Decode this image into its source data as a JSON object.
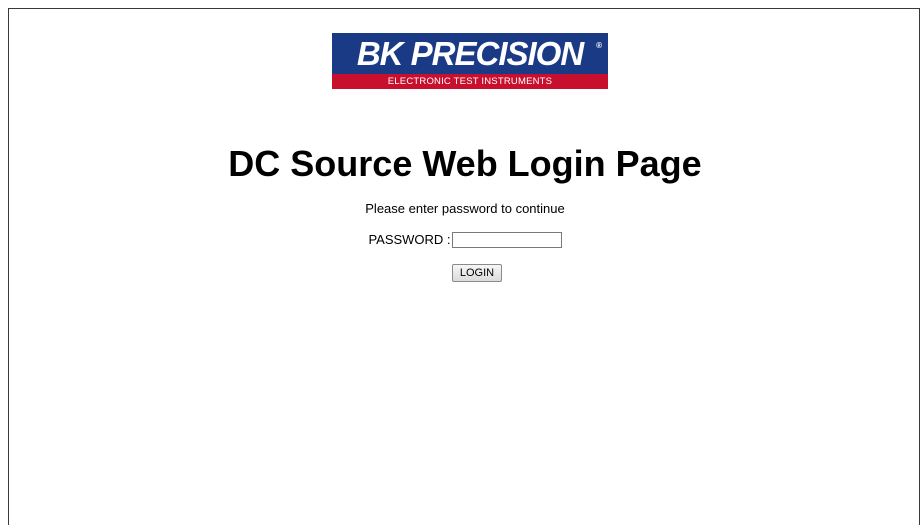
{
  "logo": {
    "brand": "BK PRECISION",
    "registered_mark": "®",
    "tagline": "ELECTRONIC TEST INSTRUMENTS",
    "colors": {
      "primary": "#1b3a86",
      "accent": "#c8102e"
    }
  },
  "page": {
    "title": "DC Source Web Login Page",
    "instruction": "Please enter password to continue"
  },
  "form": {
    "password_label": "PASSWORD :",
    "password_value": "",
    "login_label": "LOGIN"
  }
}
